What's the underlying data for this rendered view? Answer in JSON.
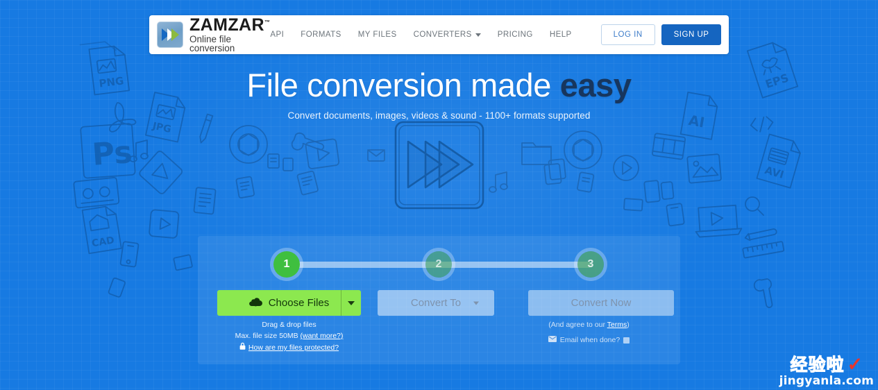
{
  "colors": {
    "page_background": "#177ae2",
    "brand_green": "#8ce84f",
    "step_active_green": "#3fbf3f",
    "signup_blue": "#1565c0",
    "headline_accent": "#17365e",
    "watermark_red": "#e8362b"
  },
  "header": {
    "logo_icon": "zamzar-chevrons-icon",
    "brand_name": "ZAMZAR",
    "brand_tm": "™",
    "tagline": "Online file conversion",
    "nav": [
      {
        "label": "API",
        "icon": null
      },
      {
        "label": "FORMATS",
        "icon": null
      },
      {
        "label": "MY FILES",
        "icon": null
      },
      {
        "label": "CONVERTERS",
        "icon": "chevron-down-icon"
      },
      {
        "label": "PRICING",
        "icon": null
      },
      {
        "label": "HELP",
        "icon": null
      }
    ],
    "login_label": "LOG IN",
    "signup_label": "SIGN UP"
  },
  "hero": {
    "headline_normal": "File conversion made ",
    "headline_strong": "easy",
    "subhead": "Convert documents, images, videos & sound - 1100+ formats supported",
    "illustration": "fast-forward-play-icon"
  },
  "widget": {
    "steps": [
      {
        "number": "1",
        "state": "active"
      },
      {
        "number": "2",
        "state": "inactive"
      },
      {
        "number": "3",
        "state": "inactive"
      }
    ],
    "choose_files": {
      "label": "Choose Files",
      "icon": "cloud-upload-icon",
      "dropdown_icon": "caret-down-icon"
    },
    "convert_to": {
      "label": "Convert To",
      "dropdown_icon": "caret-down-icon",
      "disabled": true
    },
    "convert_now": {
      "label": "Convert Now",
      "disabled": true
    },
    "notes_left": {
      "drag_drop": "Drag & drop files",
      "max_size_prefix": "Max. file size 50MB ",
      "want_more_link": "(want more?)",
      "lock_icon": "lock-icon",
      "protected_link": "How are my files protected?"
    },
    "notes_right": {
      "terms_prefix": "(And agree to our ",
      "terms_link": "Terms",
      "terms_suffix": ")",
      "email_icon": "envelope-icon",
      "email_label": "Email when done?"
    }
  },
  "background_doodles": [
    "PNG",
    "JPG",
    "PS",
    "AI",
    "EPS",
    "AVI",
    "CAD"
  ],
  "watermark": {
    "chinese_text": "经验啦",
    "check_icon": "check-mark-icon",
    "url": "jingyanla.com"
  }
}
